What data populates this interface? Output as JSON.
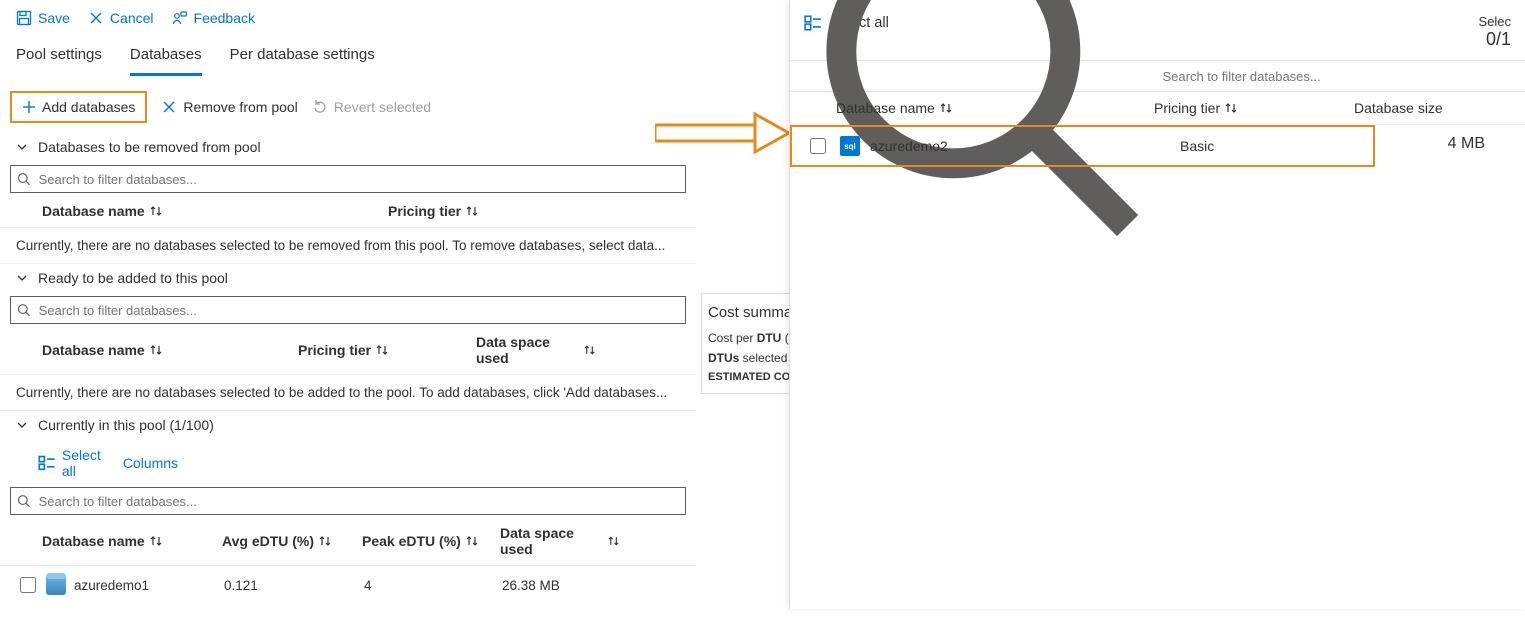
{
  "toolbar": {
    "save": "Save",
    "cancel": "Cancel",
    "feedback": "Feedback"
  },
  "tabs": {
    "pool": "Pool settings",
    "db": "Databases",
    "per": "Per database settings"
  },
  "actions": {
    "add": "Add databases",
    "remove": "Remove from pool",
    "revert": "Revert selected"
  },
  "sections": {
    "remove": {
      "title": "Databases to be removed from pool",
      "search_ph": "Search to filter databases...",
      "cols": {
        "name": "Database name",
        "tier": "Pricing tier"
      },
      "empty": "Currently, there are no databases selected to be removed from this pool. To remove databases, select data..."
    },
    "add": {
      "title": "Ready to be added to this pool",
      "search_ph": "Search to filter databases...",
      "cols": {
        "name": "Database name",
        "tier": "Pricing tier",
        "space": "Data space used"
      },
      "empty": "Currently, there are no databases selected to be added to the pool. To add databases, click 'Add databases..."
    },
    "current": {
      "title": "Currently in this pool (1/100)",
      "select_all": "Select all",
      "columns_btn": "Columns",
      "search_ph": "Search to filter databases...",
      "cols": {
        "name": "Database name",
        "avg": "Avg eDTU (%)",
        "peak": "Peak eDTU (%)",
        "space": "Data space used"
      },
      "rows": [
        {
          "name": "azuredemo1",
          "avg": "0.121",
          "peak": "4",
          "space": "26.38 MB"
        }
      ]
    }
  },
  "cost": {
    "title": "Cost summa",
    "l1a": "Cost per ",
    "l1b": "DTU",
    "l1c": " (in",
    "l2a": "DTUs",
    "l2b": " selected",
    "est": "ESTIMATED CO"
  },
  "flyout": {
    "select_all": "Select all",
    "selected_label": "Selec",
    "selected_value": "0/1",
    "search_ph": "Search to filter databases...",
    "cols": {
      "name": "Database name",
      "tier": "Pricing tier",
      "size": "Database size"
    },
    "rows": [
      {
        "name": "azuredemo2",
        "tier": "Basic",
        "size": "4 MB"
      }
    ]
  }
}
